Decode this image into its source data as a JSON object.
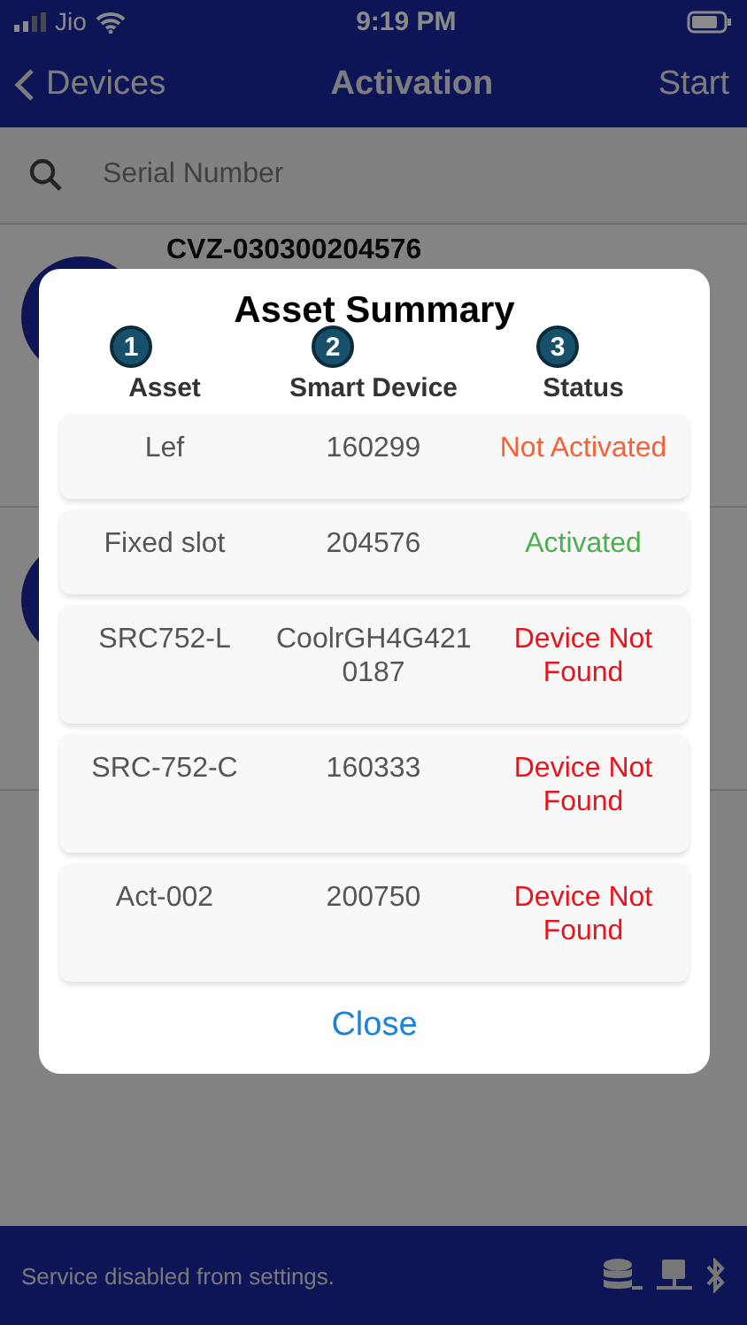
{
  "status_bar": {
    "carrier": "Jio",
    "time": "9:19 PM"
  },
  "nav": {
    "back": "Devices",
    "title": "Activation",
    "action": "Start"
  },
  "search": {
    "placeholder": "Serial Number"
  },
  "devices": [
    {
      "kind": "device",
      "serial": "CVZ-030300204576"
    },
    {
      "kind": "device"
    }
  ],
  "dialog": {
    "title": "Asset Summary",
    "columns": [
      {
        "label": "Asset",
        "marker": "1"
      },
      {
        "label": "Smart Device",
        "marker": "2"
      },
      {
        "label": "Status",
        "marker": "3"
      }
    ],
    "rows": [
      {
        "asset": "Lef",
        "device": "160299",
        "status": "Not Activated",
        "kind": "not_activated"
      },
      {
        "asset": "Fixed slot",
        "device": "204576",
        "status": "Activated",
        "kind": "activated"
      },
      {
        "asset": "SRC752-L",
        "device": "CoolrGH4G421 0187",
        "status": "Device Not Found",
        "kind": "not_found"
      },
      {
        "asset": "SRC-752-C",
        "device": "160333",
        "status": "Device Not Found",
        "kind": "not_found"
      },
      {
        "asset": "Act-002",
        "device": "200750",
        "status": "Device Not Found",
        "kind": "not_found"
      }
    ],
    "close": "Close"
  },
  "footer": {
    "message": "Service disabled from settings."
  }
}
